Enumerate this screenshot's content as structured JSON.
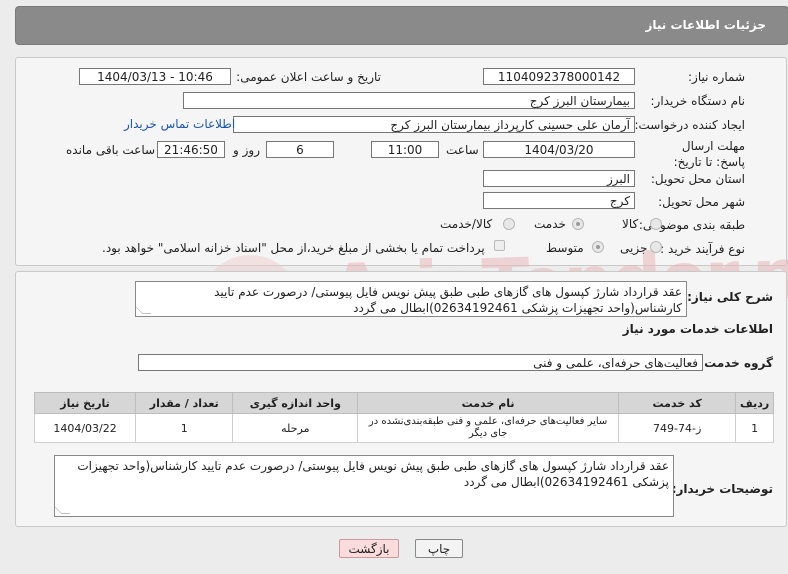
{
  "header": {
    "title": "جزئیات اطلاعات نیاز"
  },
  "form": {
    "need_number_label": "شماره نیاز:",
    "need_number": "1104092378000142",
    "announce_label": "تاریخ و ساعت اعلان عمومی:",
    "announce_value": "1404/03/13 - 10:46",
    "buyer_org_label": "نام دستگاه خریدار:",
    "buyer_org": "بیمارستان البرز کرج",
    "creator_label": "ایجاد کننده درخواست:",
    "creator": "آرمان علی حسینی کارپرداز بیمارستان البرز کرج",
    "contact_link": "اطلاعات تماس خریدار",
    "deadline_label": "مهلت ارسال پاسخ: تا تاریخ:",
    "deadline_date": "1404/03/20",
    "time_label": "ساعت",
    "deadline_time": "11:00",
    "days_value": "6",
    "days_label": "روز و",
    "remaining_time": "21:46:50",
    "remaining_label": "ساعت باقی مانده",
    "province_label": "استان محل تحویل:",
    "province": "البرز",
    "city_label": "شهر محل تحویل:",
    "city": "کرج",
    "category_label": "طبقه بندی موضوعی:",
    "category_options": [
      "کالا",
      "خدمت",
      "کالا/خدمت"
    ],
    "category_selected": "خدمت",
    "process_label": "نوع فرآیند خرید :",
    "process_options": [
      "جزیی",
      "متوسط"
    ],
    "process_selected": "متوسط",
    "payment_note": "پرداخت تمام یا بخشی از مبلغ خرید،از محل \"اسناد خزانه اسلامی\" خواهد بود."
  },
  "summary": {
    "label": "شرح کلی نیاز:",
    "text": "عقد قرارداد شارژ کپسول های گازهای طبی طبق پیش نویس فایل پیوستی/ درصورت عدم تایید کارشناس(واحد تجهیزات پزشکی 02634192461)ابطال می گردد"
  },
  "services": {
    "section_title": "اطلاعات خدمات مورد نیاز",
    "group_label": "گروه خدمت:",
    "group_value": "فعالیت‌های حرفه‌ای، علمی و فنی",
    "columns": [
      "ردیف",
      "کد خدمت",
      "نام خدمت",
      "واحد اندازه گیری",
      "تعداد / مقدار",
      "تاریخ نیاز"
    ],
    "rows": [
      {
        "row": "1",
        "code": "ز-74-749",
        "name": "سایر فعالیت‌های حرفه‌ای، علمی و فنی طبقه‌بندی‌نشده در جای دیگر",
        "unit": "مرحله",
        "qty": "1",
        "date": "1404/03/22"
      }
    ]
  },
  "buyer_notes": {
    "label": "توضیحات خریدار:",
    "text": "عقد قرارداد شارژ کپسول های گازهای طبی طبق پیش نویس فایل پیوستی/ درصورت عدم تایید کارشناس(واحد تجهیزات پزشکی 02634192461)ابطال می گردد"
  },
  "buttons": {
    "print": "چاپ",
    "back": "بازگشت"
  },
  "watermark": "AriaTender.net"
}
